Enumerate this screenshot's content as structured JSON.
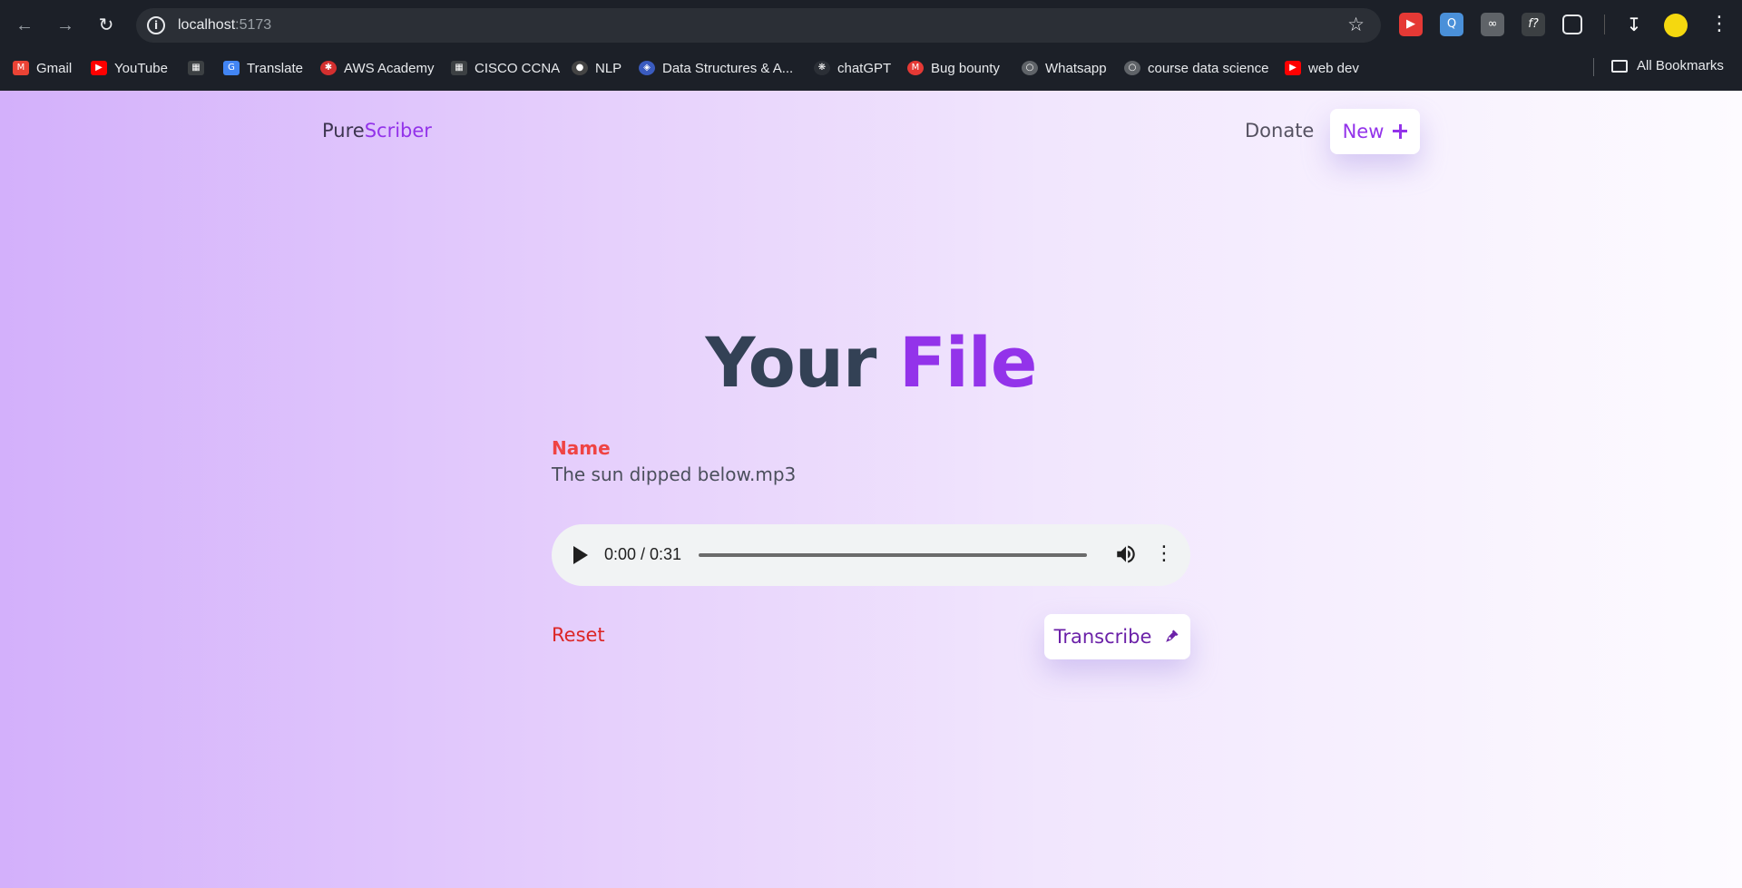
{
  "browser": {
    "url_host": "localhost",
    "url_port": ":5173",
    "bookmarks": [
      {
        "label": "Gmail",
        "icon": "gmail-icon"
      },
      {
        "label": "YouTube",
        "icon": "youtube-icon"
      },
      {
        "label": "",
        "icon": "grid-icon"
      },
      {
        "label": "Translate",
        "icon": "translate-icon"
      },
      {
        "label": "AWS Academy",
        "icon": "aws-icon"
      },
      {
        "label": "CISCO CCNA",
        "icon": "grid-icon"
      },
      {
        "label": "NLP",
        "icon": "nlp-icon"
      },
      {
        "label": "Data Structures & A...",
        "icon": "ds-icon"
      },
      {
        "label": "chatGPT",
        "icon": "chatgpt-icon"
      },
      {
        "label": "Bug bounty",
        "icon": "bug-bounty-icon"
      },
      {
        "label": "Whatsapp",
        "icon": "globe-icon"
      },
      {
        "label": "course data science",
        "icon": "globe-icon"
      },
      {
        "label": "web dev",
        "icon": "youtube-icon"
      }
    ],
    "all_bookmarks": "All Bookmarks"
  },
  "header": {
    "logo_part1": "Pure",
    "logo_part2": "Scriber",
    "donate": "Donate",
    "new_button": "New"
  },
  "main": {
    "title_part1": "Your ",
    "title_part2": "File",
    "name_label": "Name",
    "file_name": "The sun dipped below.mp3",
    "audio_time": "0:00 / 0:31",
    "reset": "Reset",
    "transcribe": "Transcribe"
  },
  "colors": {
    "accent": "#9333ea",
    "danger": "#dc2626",
    "heading": "#334155"
  }
}
